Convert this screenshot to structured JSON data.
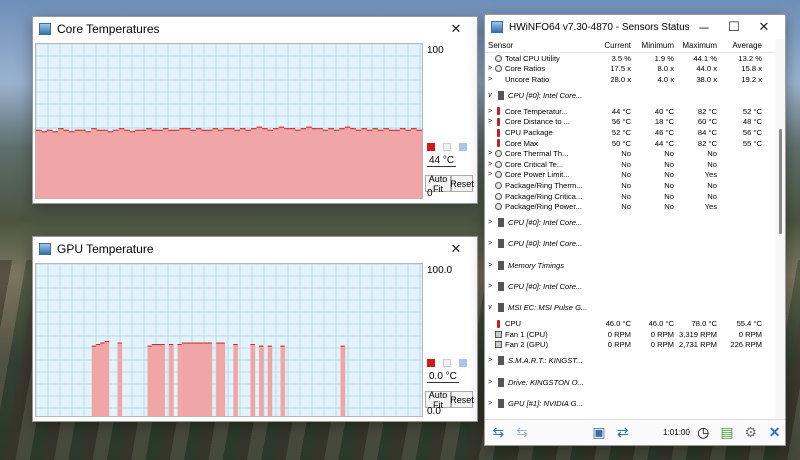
{
  "core_window": {
    "title": "Core Temperatures",
    "max_label": "100",
    "current_label": "44 °C",
    "min_label": "0",
    "auto_fit_label": "Auto Fit",
    "reset_label": "Reset",
    "colors": {
      "line": "#d21a1a",
      "fill": "#f0a6a6",
      "grid": "#b9ddea",
      "bg": "#e3f3fb"
    }
  },
  "gpu_window": {
    "title": "GPU Temperature",
    "max_label": "100.0",
    "current_label": "0.0 °C",
    "min_label": "0.0",
    "auto_fit_label": "Auto Fit",
    "reset_label": "Reset"
  },
  "chart_data": [
    {
      "type": "area",
      "name": "Core Temperatures",
      "ylim": [
        0,
        100
      ],
      "grid": true,
      "values": [
        44,
        43,
        44,
        43,
        45,
        44,
        43,
        44,
        44,
        43,
        45,
        44,
        44,
        43,
        44,
        45,
        44,
        43,
        44,
        44,
        45,
        44,
        44,
        45,
        44,
        44,
        45,
        45,
        44,
        45,
        44,
        44,
        45,
        44,
        45,
        45,
        44,
        45,
        44,
        45,
        46,
        45,
        44,
        45,
        46,
        45,
        45,
        44,
        45,
        46,
        45,
        45,
        44,
        45,
        44,
        45,
        46,
        45,
        44,
        45,
        44,
        45,
        44,
        45,
        44,
        44,
        45,
        44,
        45,
        44
      ]
    },
    {
      "type": "area",
      "name": "GPU Temperature",
      "ylim": [
        0,
        100
      ],
      "grid": true,
      "values": [
        0,
        0,
        0,
        0,
        0,
        0,
        0,
        0,
        0,
        0,
        0,
        0,
        0,
        46,
        47,
        48,
        49,
        0,
        0,
        48,
        0,
        0,
        0,
        0,
        0,
        0,
        46,
        47,
        47,
        47,
        0,
        47,
        0,
        47,
        48,
        48,
        48,
        48,
        48,
        48,
        48,
        0,
        48,
        48,
        0,
        0,
        47,
        0,
        0,
        0,
        47,
        0,
        46,
        0,
        46,
        0,
        0,
        46,
        0,
        0,
        0,
        0,
        0,
        0,
        0,
        0,
        0,
        0,
        0,
        0,
        0,
        46,
        0,
        0,
        0,
        0,
        0,
        0,
        0,
        0,
        0,
        0,
        0,
        0,
        0,
        0,
        0,
        0,
        0,
        0
      ]
    }
  ],
  "hwinfo": {
    "title": "HWiNFO64 v7.30-4870 - Sensors Status",
    "columns": [
      "Sensor",
      "Current",
      "Minimum",
      "Maximum",
      "Average"
    ],
    "rows": [
      {
        "kind": "row",
        "tw": "",
        "icon": "clock",
        "name": "Total CPU Utility",
        "cur": "3.5 %",
        "min": "1.9 %",
        "max": "44.1 %",
        "avg": "13.2 %"
      },
      {
        "kind": "row",
        "tw": ">",
        "icon": "clock",
        "name": "Core Ratios",
        "cur": "17.5 x",
        "min": "8.0 x",
        "max": "44.0 x",
        "avg": "15.8 x"
      },
      {
        "kind": "row",
        "tw": ">",
        "icon": "",
        "name": "Uncore Ratio",
        "cur": "28.0 x",
        "min": "4.0 x",
        "max": "38.0 x",
        "avg": "19.2 x"
      },
      {
        "kind": "sec",
        "tw": "v",
        "name": "CPU [#0]: Intel Core..."
      },
      {
        "kind": "row",
        "tw": ">",
        "icon": "therm",
        "name": "Core Temperatur...",
        "cur": "44 °C",
        "min": "40 °C",
        "max": "82 °C",
        "avg": "52 °C"
      },
      {
        "kind": "row",
        "tw": ">",
        "icon": "therm",
        "name": "Core Distance to ...",
        "cur": "56 °C",
        "min": "18 °C",
        "max": "60 °C",
        "avg": "48 °C"
      },
      {
        "kind": "row",
        "tw": "",
        "icon": "therm",
        "name": "CPU Package",
        "cur": "52 °C",
        "min": "46 °C",
        "max": "84 °C",
        "avg": "56 °C"
      },
      {
        "kind": "row",
        "tw": "",
        "icon": "therm",
        "name": "Core Max",
        "cur": "50 °C",
        "min": "44 °C",
        "max": "82 °C",
        "avg": "55 °C"
      },
      {
        "kind": "row",
        "tw": ">",
        "icon": "clock",
        "name": "Core Thermal Th...",
        "cur": "No",
        "min": "No",
        "max": "No",
        "avg": ""
      },
      {
        "kind": "row",
        "tw": ">",
        "icon": "clock",
        "name": "Core Critical Te...",
        "cur": "No",
        "min": "No",
        "max": "No",
        "avg": ""
      },
      {
        "kind": "row",
        "tw": ">",
        "icon": "clock",
        "name": "Core Power Limit...",
        "cur": "No",
        "min": "No",
        "max": "Yes",
        "avg": ""
      },
      {
        "kind": "row",
        "tw": "",
        "icon": "clock",
        "name": "Package/Ring Therm...",
        "cur": "No",
        "min": "No",
        "max": "No",
        "avg": ""
      },
      {
        "kind": "row",
        "tw": "",
        "icon": "clock",
        "name": "Package/Ring Critica...",
        "cur": "No",
        "min": "No",
        "max": "No",
        "avg": ""
      },
      {
        "kind": "row",
        "tw": "",
        "icon": "clock",
        "name": "Package/Ring Power...",
        "cur": "No",
        "min": "No",
        "max": "Yes",
        "avg": ""
      },
      {
        "kind": "sec",
        "tw": ">",
        "name": "CPU [#0]: Intel Core..."
      },
      {
        "kind": "sec",
        "tw": ">",
        "name": "CPU [#0]: Intel Core..."
      },
      {
        "kind": "sec",
        "tw": ">",
        "name": "Memory Timings"
      },
      {
        "kind": "sec",
        "tw": ">",
        "name": "CPU [#0]: Intel Core..."
      },
      {
        "kind": "sec",
        "tw": "v",
        "name": "MSI EC: MSI Pulse G..."
      },
      {
        "kind": "row",
        "tw": "",
        "icon": "therm",
        "name": "CPU",
        "cur": "46.0 °C",
        "min": "46.0 °C",
        "max": "78.0 °C",
        "avg": "55.4 °C"
      },
      {
        "kind": "row",
        "tw": "",
        "icon": "fan",
        "name": "Fan 1 (CPU)",
        "cur": "0 RPM",
        "min": "0 RPM",
        "max": "3,319 RPM",
        "avg": "0 RPM"
      },
      {
        "kind": "row",
        "tw": "",
        "icon": "fan",
        "name": "Fan 2 (GPU)",
        "cur": "0 RPM",
        "min": "0 RPM",
        "max": "2,731 RPM",
        "avg": "226 RPM"
      },
      {
        "kind": "sec",
        "tw": ">",
        "name": "S.M.A.R.T.: KINGST..."
      },
      {
        "kind": "sec",
        "tw": ">",
        "name": "Drive: KINGSTON O..."
      },
      {
        "kind": "sec",
        "tw": ">",
        "name": "GPU [#1]: NVIDIA G..."
      }
    ],
    "timer_label": "1:01:00"
  }
}
